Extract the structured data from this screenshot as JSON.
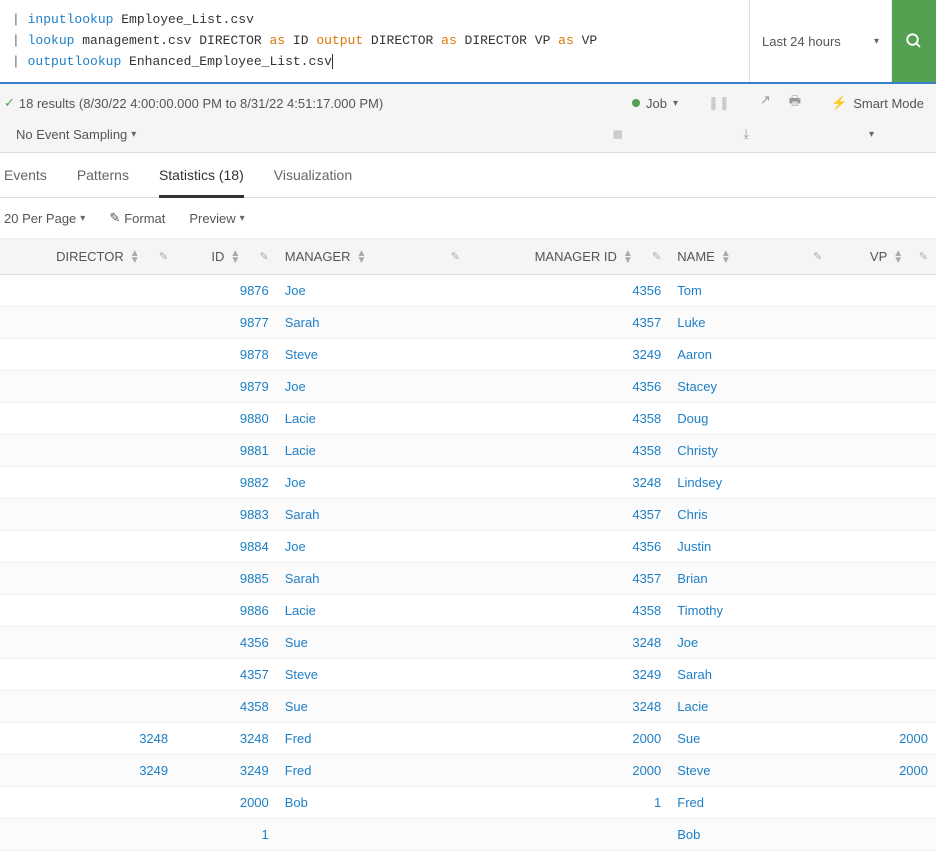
{
  "search": {
    "q_line1_pipe": "|",
    "q_line1_cmd": "inputlookup",
    "q_line1_rest": " Employee_List.csv",
    "q_line2_pipe": "|",
    "q_line2_cmd": "lookup",
    "q_line2_a": " management.csv DIRECTOR ",
    "q_line2_as1": "as",
    "q_line2_b": " ID ",
    "q_line2_out": "output",
    "q_line2_c": " DIRECTOR ",
    "q_line2_as2": "as",
    "q_line2_d": " DIRECTOR VP ",
    "q_line2_as3": "as",
    "q_line2_e": " VP",
    "q_line3_pipe": "|",
    "q_line3_cmd": "outputlookup",
    "q_line3_rest": " Enhanced_Employee_List.csv",
    "time_range": "Last 24 hours"
  },
  "status": {
    "results_text": "18 results (8/30/22 4:00:00.000 PM to 8/31/22 4:51:17.000 PM)",
    "job_label": "Job",
    "smart_mode_label": "Smart Mode",
    "sampling_label": "No Event Sampling"
  },
  "tabs": {
    "events": "Events",
    "patterns": "Patterns",
    "statistics": "Statistics (18)",
    "visualization": "Visualization"
  },
  "toolbar": {
    "per_page": "20 Per Page",
    "format": "Format",
    "preview": "Preview"
  },
  "columns": {
    "director": "DIRECTOR",
    "id": "ID",
    "manager": "MANAGER",
    "manager_id": "MANAGER ID",
    "name": "NAME",
    "vp": "VP"
  },
  "rows": [
    {
      "director": "",
      "id": "9876",
      "manager": "Joe",
      "manager_id": "4356",
      "name": "Tom",
      "vp": ""
    },
    {
      "director": "",
      "id": "9877",
      "manager": "Sarah",
      "manager_id": "4357",
      "name": "Luke",
      "vp": ""
    },
    {
      "director": "",
      "id": "9878",
      "manager": "Steve",
      "manager_id": "3249",
      "name": "Aaron",
      "vp": ""
    },
    {
      "director": "",
      "id": "9879",
      "manager": "Joe",
      "manager_id": "4356",
      "name": "Stacey",
      "vp": ""
    },
    {
      "director": "",
      "id": "9880",
      "manager": "Lacie",
      "manager_id": "4358",
      "name": "Doug",
      "vp": ""
    },
    {
      "director": "",
      "id": "9881",
      "manager": "Lacie",
      "manager_id": "4358",
      "name": "Christy",
      "vp": ""
    },
    {
      "director": "",
      "id": "9882",
      "manager": "Joe",
      "manager_id": "3248",
      "name": "Lindsey",
      "vp": ""
    },
    {
      "director": "",
      "id": "9883",
      "manager": "Sarah",
      "manager_id": "4357",
      "name": "Chris",
      "vp": ""
    },
    {
      "director": "",
      "id": "9884",
      "manager": "Joe",
      "manager_id": "4356",
      "name": "Justin",
      "vp": ""
    },
    {
      "director": "",
      "id": "9885",
      "manager": "Sarah",
      "manager_id": "4357",
      "name": "Brian",
      "vp": ""
    },
    {
      "director": "",
      "id": "9886",
      "manager": "Lacie",
      "manager_id": "4358",
      "name": "Timothy",
      "vp": ""
    },
    {
      "director": "",
      "id": "4356",
      "manager": "Sue",
      "manager_id": "3248",
      "name": "Joe",
      "vp": ""
    },
    {
      "director": "",
      "id": "4357",
      "manager": "Steve",
      "manager_id": "3249",
      "name": "Sarah",
      "vp": ""
    },
    {
      "director": "",
      "id": "4358",
      "manager": "Sue",
      "manager_id": "3248",
      "name": "Lacie",
      "vp": ""
    },
    {
      "director": "3248",
      "id": "3248",
      "manager": "Fred",
      "manager_id": "2000",
      "name": "Sue",
      "vp": "2000"
    },
    {
      "director": "3249",
      "id": "3249",
      "manager": "Fred",
      "manager_id": "2000",
      "name": "Steve",
      "vp": "2000"
    },
    {
      "director": "",
      "id": "2000",
      "manager": "Bob",
      "manager_id": "1",
      "name": "Fred",
      "vp": ""
    },
    {
      "director": "",
      "id": "1",
      "manager": "",
      "manager_id": "",
      "name": "Bob",
      "vp": ""
    }
  ]
}
